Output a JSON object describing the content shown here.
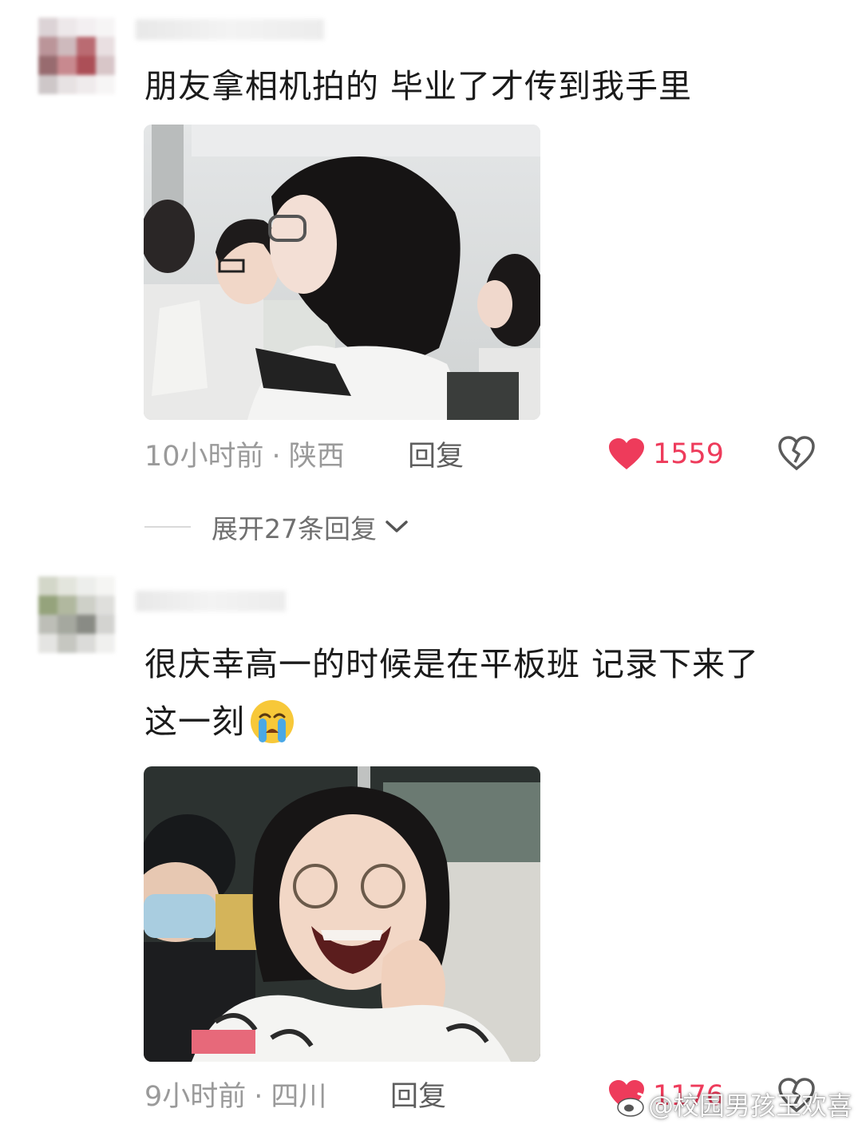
{
  "comments": [
    {
      "text_lines": [
        "朋友拿相机拍的 毕业了才传到我手里"
      ],
      "time": "10小时前",
      "separator": "·",
      "location": "陕西",
      "reply_label": "回复",
      "likes": "1559",
      "expand_label": "展开27条回复"
    },
    {
      "text_lines": [
        "很庆幸高一的时候是在平板班 记录下来了",
        "这一刻"
      ],
      "time": "9小时前",
      "separator": "·",
      "location": "四川",
      "reply_label": "回复",
      "likes": "1176"
    }
  ],
  "watermark": "@校园男孩王欢喜",
  "colors": {
    "like": "#ee3b5b",
    "meta": "#9a9a9a",
    "text": "#1b1b1b"
  }
}
